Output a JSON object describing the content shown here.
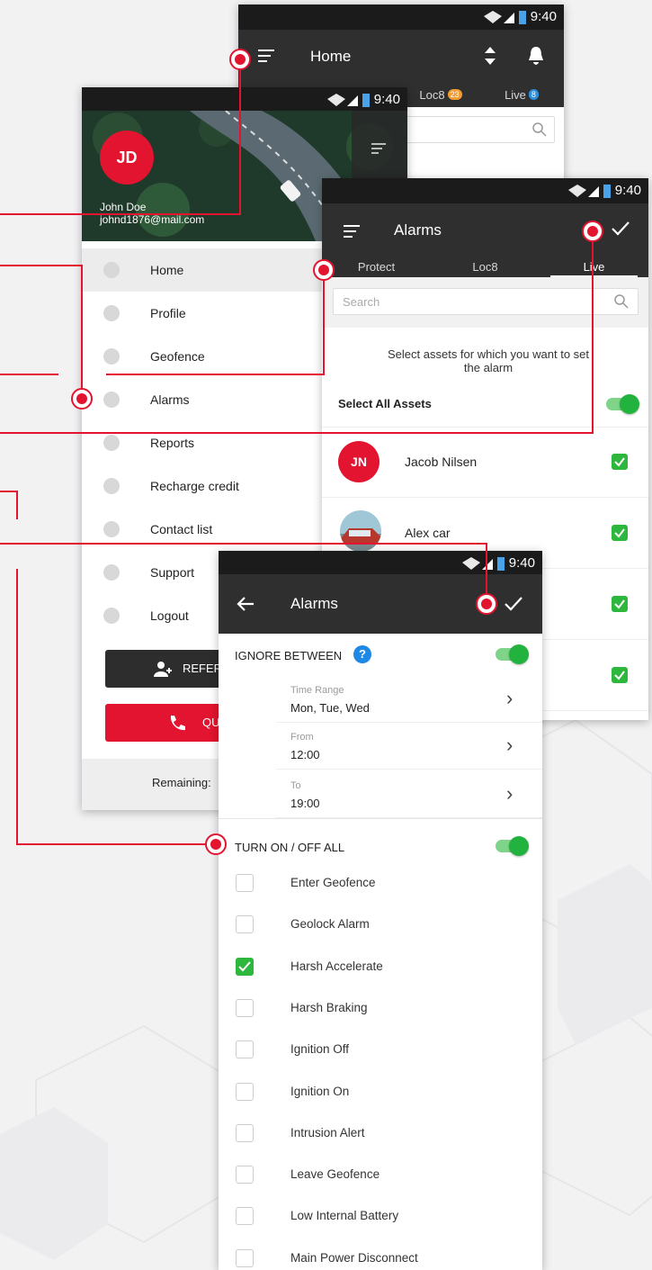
{
  "colors": {
    "accent": "#e3142f",
    "toggle_on": "#22b33f",
    "appbar": "#2f2f2f",
    "statusbar": "#1b1b1b"
  },
  "status": {
    "time": "9:40"
  },
  "home_screen": {
    "title": "Home",
    "tabs": [
      "Loc8",
      "Live"
    ],
    "badges": {
      "loc8": "23",
      "live": "8"
    }
  },
  "drawer": {
    "avatar_initials": "JD",
    "user_name": "John Doe",
    "user_email": "johnd1876@mail.com",
    "menu": [
      {
        "label": "Home",
        "icon": "home-icon"
      },
      {
        "label": "Profile",
        "icon": "gear-icon"
      },
      {
        "label": "Geofence",
        "icon": "geofence-icon"
      },
      {
        "label": "Alarms",
        "icon": "alarm-icon"
      },
      {
        "label": "Reports",
        "icon": "reports-icon"
      },
      {
        "label": "Recharge credit",
        "icon": "card-icon"
      },
      {
        "label": "Contact list",
        "icon": "contacts-icon"
      },
      {
        "label": "Support",
        "icon": "support-icon"
      },
      {
        "label": "Logout",
        "icon": "power-icon"
      }
    ],
    "refer_button": "REFER",
    "quick_button": "QU",
    "remaining_label": "Remaining:"
  },
  "alarms_assets": {
    "title": "Alarms",
    "tabs": [
      "Protect",
      "Loc8",
      "Live"
    ],
    "active_tab": "Live",
    "search_placeholder": "Search",
    "instruction": "Select assets for which you want to set the alarm",
    "select_all_label": "Select All Assets",
    "select_all_on": true,
    "assets": [
      {
        "name": "Jacob Nilsen",
        "initials": "JN",
        "checked": true
      },
      {
        "name": "Alex car",
        "checked": true
      },
      {
        "name": "",
        "checked": true
      },
      {
        "name": "",
        "checked": true
      }
    ]
  },
  "alarms_settings": {
    "title": "Alarms",
    "ignore_between_label": "IGNORE BETWEEN",
    "ignore_between_on": true,
    "time_range_label": "Time Range",
    "time_range_value": "Mon, Tue, Wed",
    "from_label": "From",
    "from_value": "12:00",
    "to_label": "To",
    "to_value": "19:00",
    "turn_all_label": "TURN ON / OFF ALL",
    "turn_all_on": true,
    "options": [
      {
        "label": "Enter Geofence",
        "checked": false
      },
      {
        "label": "Geolock Alarm",
        "checked": false
      },
      {
        "label": "Harsh Accelerate",
        "checked": true
      },
      {
        "label": "Harsh Braking",
        "checked": false
      },
      {
        "label": "Ignition Off",
        "checked": false
      },
      {
        "label": "Ignition On",
        "checked": false
      },
      {
        "label": "Intrusion Alert",
        "checked": false
      },
      {
        "label": "Leave Geofence",
        "checked": false
      },
      {
        "label": "Low Internal Battery",
        "checked": false
      },
      {
        "label": "Main Power Disconnect",
        "checked": false
      }
    ]
  }
}
